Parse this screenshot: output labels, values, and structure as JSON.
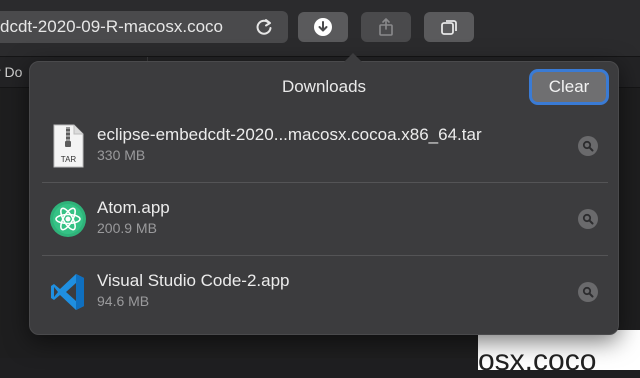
{
  "toolbar": {
    "address_text": "dcdt-2020-09-R-macosx.coco",
    "buttons": [
      {
        "name": "downloads",
        "icon": "download-icon"
      },
      {
        "name": "share",
        "icon": "share-icon"
      },
      {
        "name": "tabs",
        "icon": "tab-overview-icon"
      }
    ]
  },
  "tabbar": {
    "left_tab_label": "r Do"
  },
  "background": {
    "partial_text": "osx.coco"
  },
  "downloads": {
    "title": "Downloads",
    "clear_label": "Clear",
    "items": [
      {
        "name": "eclipse-embedcdt-2020...macosx.cocoa.x86_64.tar",
        "size": "330 MB",
        "icon": "tar-archive-icon",
        "icon_label": "TAR"
      },
      {
        "name": "Atom.app",
        "size": "200.9 MB",
        "icon": "atom-app-icon"
      },
      {
        "name": "Visual Studio Code-2.app",
        "size": "94.6 MB",
        "icon": "vscode-app-icon"
      }
    ]
  },
  "colors": {
    "accent_focus": "#3a7bd5",
    "atom_green": "#2fb37a",
    "vscode_blue": "#1f8fe0"
  }
}
